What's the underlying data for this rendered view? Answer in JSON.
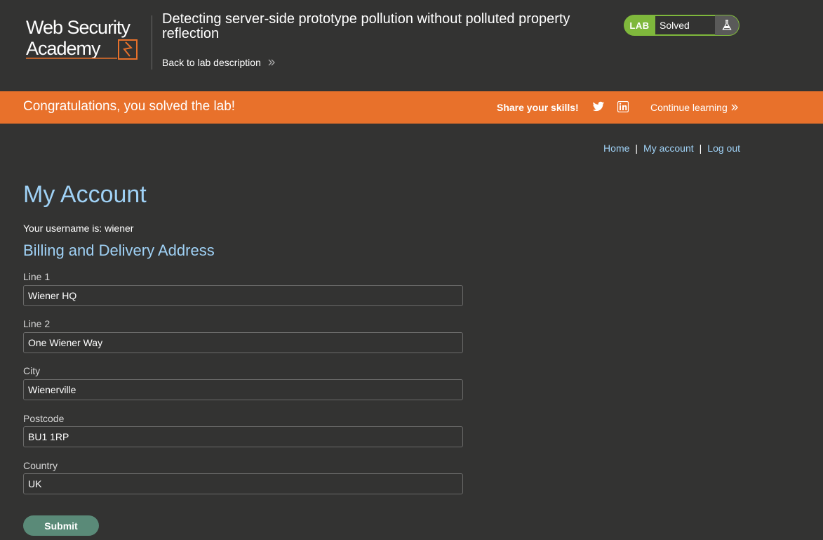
{
  "header": {
    "logo_line1": "Web Security",
    "logo_line2": "Academy",
    "lab_title": "Detecting server-side prototype pollution without polluted property reflection",
    "back_link": "Back to lab description",
    "lab_badge": "LAB",
    "lab_status": "Solved"
  },
  "banner": {
    "congrats": "Congratulations, you solved the lab!",
    "share": "Share your skills!",
    "continue": "Continue learning"
  },
  "nav": {
    "home": "Home",
    "sep": "|",
    "my_account": "My account",
    "log_out": "Log out"
  },
  "main": {
    "title": "My Account",
    "username_line": "Your username is: wiener",
    "section_title": "Billing and Delivery Address",
    "fields": [
      {
        "label": "Line 1",
        "value": "Wiener HQ"
      },
      {
        "label": "Line 2",
        "value": "One Wiener Way"
      },
      {
        "label": "City",
        "value": "Wienerville"
      },
      {
        "label": "Postcode",
        "value": "BU1 1RP"
      },
      {
        "label": "Country",
        "value": "UK"
      }
    ],
    "submit": "Submit"
  },
  "colors": {
    "background": "#333332",
    "banner": "#e8712b",
    "link": "#9fd1f5",
    "lab_green": "#7fb83c",
    "submit": "#5a8a78"
  }
}
